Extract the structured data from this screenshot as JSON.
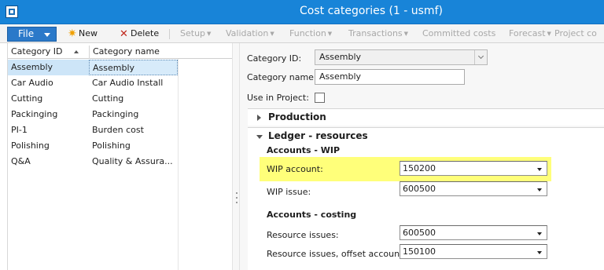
{
  "window": {
    "title": "Cost categories (1 - usmf)",
    "accent_color": "#1884d8"
  },
  "toolbar": {
    "file_label": "File",
    "new_label": "New",
    "delete_label": "Delete",
    "setup_label": "Setup",
    "validation_label": "Validation",
    "function_label": "Function",
    "transactions_label": "Transactions",
    "committed_costs_label": "Committed costs",
    "forecast_label": "Forecast",
    "project_label": "Project co"
  },
  "grid": {
    "columns": [
      "Category ID",
      "Category name"
    ],
    "rows": [
      {
        "id": "Assembly",
        "name": "Assembly",
        "selected": true
      },
      {
        "id": "Car Audio",
        "name": "Car Audio Install"
      },
      {
        "id": "Cutting",
        "name": "Cutting"
      },
      {
        "id": "Packinging",
        "name": "Packinging"
      },
      {
        "id": "PI-1",
        "name": "Burden cost"
      },
      {
        "id": "Polishing",
        "name": "Polishing"
      },
      {
        "id": "Q&A",
        "name": "Quality & Assura..."
      }
    ]
  },
  "detail": {
    "category_id_label": "Category ID:",
    "category_id_value": "Assembly",
    "category_name_label": "Category name:",
    "category_name_value": "Assembly",
    "use_in_project_label": "Use in Project:",
    "use_in_project_checked": false,
    "production_tab": "Production",
    "ledger_tab": "Ledger - resources",
    "accounts_wip_title": "Accounts - WIP",
    "wip_account_label": "WIP account:",
    "wip_account_value": "150200",
    "wip_issue_label": "WIP issue:",
    "wip_issue_value": "600500",
    "accounts_costing_title": "Accounts - costing",
    "resource_issues_label": "Resource issues:",
    "resource_issues_value": "600500",
    "resource_offset_label": "Resource issues, offset account:",
    "resource_offset_value": "150100",
    "highlight_color": "#ffff7a"
  }
}
